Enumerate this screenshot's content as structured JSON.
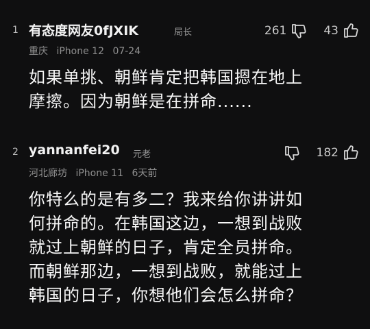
{
  "comments": [
    {
      "index": "1",
      "username": "有态度网友0fJXIK",
      "role": "局长",
      "location": "重庆",
      "device": "iPhone 12",
      "time": "07-24",
      "text_line1": "如果单挑、朝鲜肯定把韩国摁在地上",
      "text_line2": "摩擦。因为朝鲜是在拼命......",
      "dislike_count": "261",
      "like_count": "43"
    },
    {
      "index": "2",
      "username": "yannanfei20",
      "role": "元老",
      "location": "河北廊坊",
      "device": "iPhone 11",
      "time": "6天前",
      "text_line1": "你特么的是有多二？我来给你讲讲如",
      "text_line2": "何拼命的。在韩国这边，一想到战败",
      "text_line3": "就过上朝鲜的日子，肯定全员拼命。",
      "text_line4": "而朝鲜那边，一想到战败，就能过上",
      "text_line5": "韩国的日子，你想他们会怎么拼命？",
      "dislike_count": "",
      "like_count": "182"
    }
  ],
  "icons": {
    "dislike": "thumbs-down-icon",
    "like": "thumbs-up-icon"
  },
  "colors": {
    "background": "#0f0f10",
    "text": "#f7f7f7",
    "meta": "#8f8f8f"
  }
}
